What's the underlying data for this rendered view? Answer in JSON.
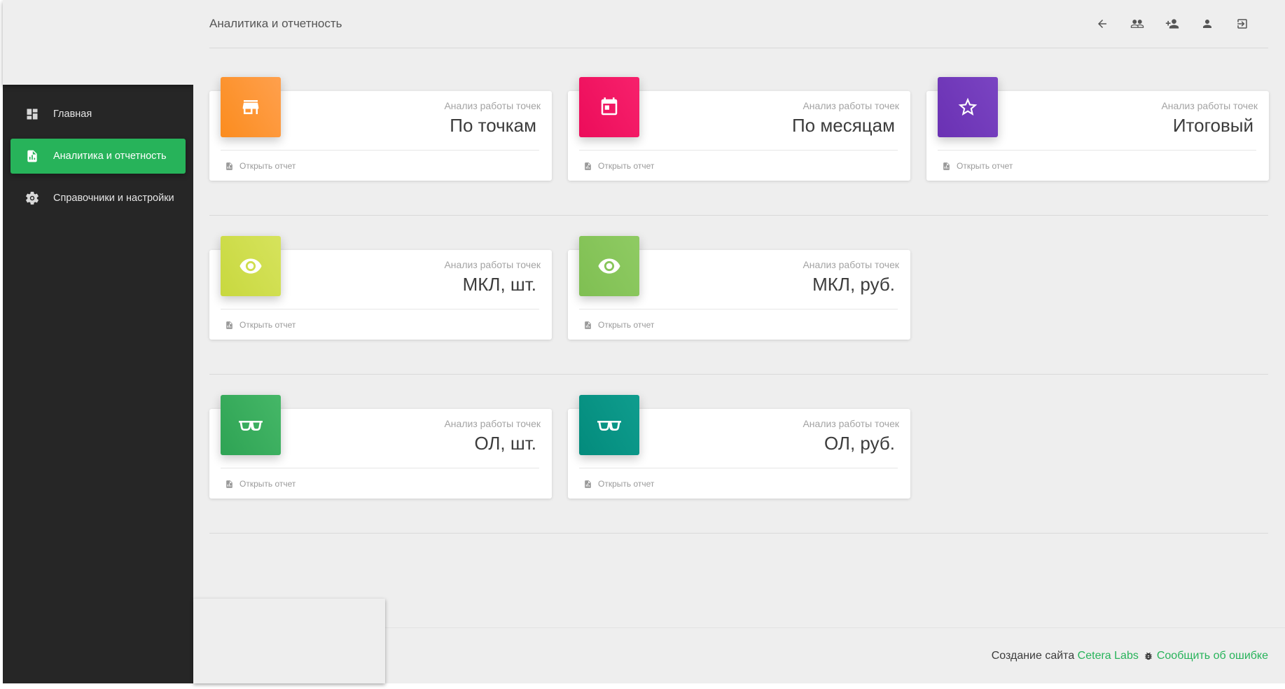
{
  "page": {
    "title": "Аналитика и отчетность"
  },
  "sidebar": {
    "items": [
      {
        "label": "Главная",
        "icon": "dashboard-icon",
        "active": false
      },
      {
        "label": "Аналитика и отчетность",
        "icon": "report-icon",
        "active": true
      },
      {
        "label": "Справочники и настройки",
        "icon": "gear-icon",
        "active": false
      }
    ]
  },
  "toolbar": {
    "icons": [
      "back-arrow-icon",
      "group-icon",
      "add-user-icon",
      "user-icon",
      "logout-icon"
    ]
  },
  "cards": [
    {
      "category": "Анализ работы точек",
      "title": "По точкам",
      "footer": "Открыть отчет",
      "color": "#fb8f2c",
      "icon": "store-icon"
    },
    {
      "category": "Анализ работы точек",
      "title": "По месяцам",
      "footer": "Открыть отчет",
      "color": "#f0115f",
      "icon": "calendar-icon"
    },
    {
      "category": "Анализ работы точек",
      "title": "Итоговый",
      "footer": "Открыть отчет",
      "color": "#6f37b8",
      "icon": "star-icon"
    },
    {
      "category": "Анализ работы точек",
      "title": "МКЛ, шт.",
      "footer": "Открыть отчет",
      "color": "#cddc4a",
      "icon": "eye-icon"
    },
    {
      "category": "Анализ работы точек",
      "title": "МКЛ, руб.",
      "footer": "Открыть отчет",
      "color": "#86c45a",
      "icon": "eye-icon"
    },
    {
      "category": "Анализ работы точек",
      "title": "ОЛ, шт.",
      "footer": "Открыть отчет",
      "color": "#33a85a",
      "icon": "glasses-icon"
    },
    {
      "category": "Анализ работы точек",
      "title": "ОЛ, руб.",
      "footer": "Открыть отчет",
      "color": "#089686",
      "icon": "glasses-icon"
    }
  ],
  "footer": {
    "prefix": "Создание сайта",
    "company": "Cetera Labs",
    "report_link": "Сообщить об ошибке"
  },
  "colors": {
    "accent": "#27b35a",
    "sidebar_bg": "#262626",
    "main_bg": "#eeeeee"
  }
}
